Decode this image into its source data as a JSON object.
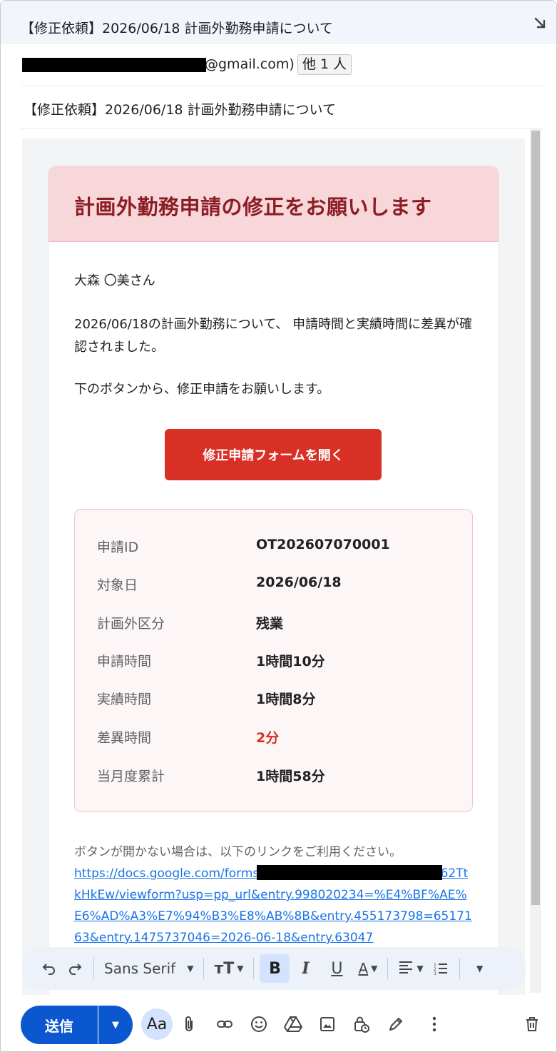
{
  "window": {
    "subject_title": "【修正依頼】2026/06/18 計画外勤務申請について",
    "expand_icon": "arrow-diagonal-icon"
  },
  "recipients": {
    "visible_text": "@gmail.com)",
    "others_chip": "他 1 人"
  },
  "subject_field": {
    "value": "【修正依頼】2026/06/18 計画外勤務申請について"
  },
  "email": {
    "header_title": "計画外勤務申請の修正をお願いします",
    "greeting": "大森 〇美さん",
    "paragraph1": "2026/06/18の計画外勤務について、 申請時間と実績時間に差異が確認されました。",
    "paragraph2": "下のボタンから、修正申請をお願いします。",
    "cta_label": "修正申請フォームを開く",
    "details": [
      {
        "label": "申請ID",
        "value": "OT202607070001"
      },
      {
        "label": "対象日",
        "value": "2026/06/18"
      },
      {
        "label": "計画外区分",
        "value": "残業"
      },
      {
        "label": "申請時間",
        "value": "1時間10分"
      },
      {
        "label": "実績時間",
        "value": "1時間8分"
      },
      {
        "label": "差異時間",
        "value": "2分"
      },
      {
        "label": "当月度累計",
        "value": "1時間58分"
      }
    ],
    "fallback_note": "ボタンが開かない場合は、以下のリンクをご利用ください。",
    "fallback_link": "https://docs.google.com/forms/d/e/                              EMlHkgGGGsEjZt-NDZab62TtkHkEw/viewform?usp=pp_url&entry.998020234=%E4%BF%AE%E6%AD%A3%E7%94%B3%E8%AB%8B&entry.455173798=6517163&entry.1475737046=2026-06-18&entry.63047"
  },
  "format_toolbar": {
    "undo_icon": "undo-icon",
    "redo_icon": "redo-icon",
    "font_name": "Sans Serif",
    "font_size_icon": "text-size-icon",
    "bold": "B",
    "italic": "I",
    "underline": "U",
    "text_color": "A",
    "align_icon": "align-left-icon",
    "numbered_list_icon": "numbered-list-icon",
    "more_icon": "chevron-down-icon"
  },
  "bottom_toolbar": {
    "send_label": "送信",
    "formatting_label": "Aa"
  },
  "colors": {
    "accent_red": "#d93025",
    "header_bg": "#f8d7da",
    "header_text": "#8b1e24",
    "send_blue": "#0b57d0",
    "link_blue": "#1a73e8"
  }
}
